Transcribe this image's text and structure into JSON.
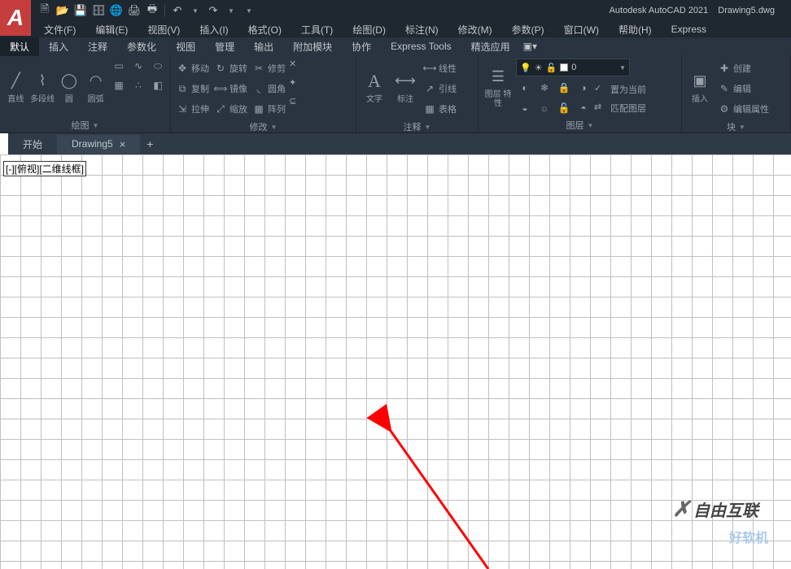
{
  "titlebar": {
    "app_name": "Autodesk AutoCAD 2021",
    "document": "Drawing5.dwg"
  },
  "menubar": {
    "items": [
      "文件(F)",
      "编辑(E)",
      "视图(V)",
      "插入(I)",
      "格式(O)",
      "工具(T)",
      "绘图(D)",
      "标注(N)",
      "修改(M)",
      "参数(P)",
      "窗口(W)",
      "帮助(H)",
      "Express"
    ]
  },
  "ribbon_tabs": [
    "默认",
    "插入",
    "注释",
    "参数化",
    "视图",
    "管理",
    "输出",
    "附加模块",
    "协作",
    "Express Tools",
    "精选应用"
  ],
  "ribbon_active_tab": "默认",
  "panels": {
    "draw": {
      "title": "绘图",
      "line": "直线",
      "polyline": "多段线",
      "circle": "圆",
      "arc": "圆弧"
    },
    "modify": {
      "title": "修改",
      "move": "移动",
      "rotate": "旋转",
      "trim": "修剪",
      "copy": "复制",
      "mirror": "镜像",
      "fillet": "圆角",
      "stretch": "拉伸",
      "scale": "缩放",
      "array": "阵列"
    },
    "annotate": {
      "title": "注释",
      "text": "文字",
      "dim": "标注",
      "linear": "线性",
      "leader": "引线",
      "table": "表格"
    },
    "layer": {
      "title": "图层",
      "props": "图层\n特性",
      "current_layer": "0",
      "set_current": "置为当前",
      "match": "匹配图层"
    },
    "block": {
      "title": "块",
      "insert": "插入",
      "create": "创建",
      "edit": "编辑",
      "edit_attr": "编辑属性"
    }
  },
  "doc_tabs": {
    "start": "开始",
    "drawing": "Drawing5"
  },
  "viewport_label": "[-][俯视][二维线框]",
  "watermark1": "自由互联",
  "watermark2": "好软机"
}
